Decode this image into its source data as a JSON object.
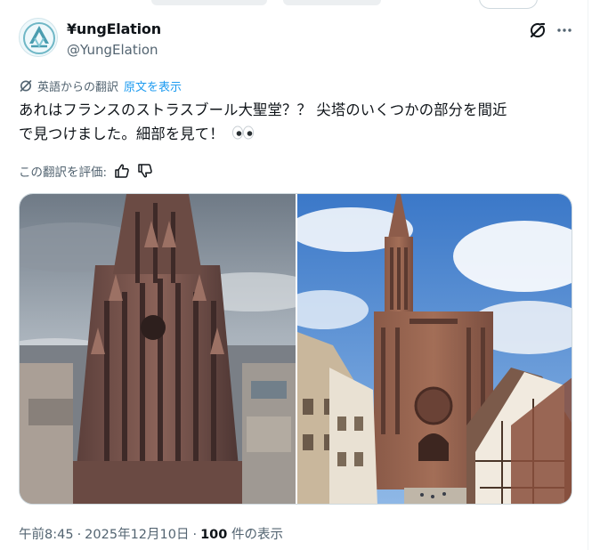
{
  "author": {
    "display_name": "¥ungElation",
    "handle": "@YungElation",
    "avatar_icon": "yungelation-logo-avatar"
  },
  "header_icons": [
    "grok-icon",
    "more-icon"
  ],
  "translation": {
    "label": "英語からの翻訳",
    "show_original": "原文を表示",
    "icon": "translate-icon"
  },
  "tweet": {
    "text_line_1": "あれはフランスのストラスブール大聖堂？？ 尖塔のいくつかの部分を間近",
    "text_line_2": "で見つけました。細部を見て！",
    "emoji": "eyes-emoji"
  },
  "rating": {
    "label": "この翻訳を評価:",
    "thumbs_up_icon": "thumbs-up-icon",
    "thumbs_down_icon": "thumbs-down-icon"
  },
  "media": {
    "images": [
      "cathedral-spire-closeup-photo",
      "cathedral-facade-street-photo"
    ]
  },
  "meta": {
    "time": "午前8:45",
    "date": "2025年12月10日",
    "views_count": "100",
    "views_label": "件の表示"
  },
  "colors": {
    "accent": "#1d9bf0",
    "text_primary": "#0f1419",
    "text_secondary": "#536471",
    "border": "#cfd9de"
  }
}
